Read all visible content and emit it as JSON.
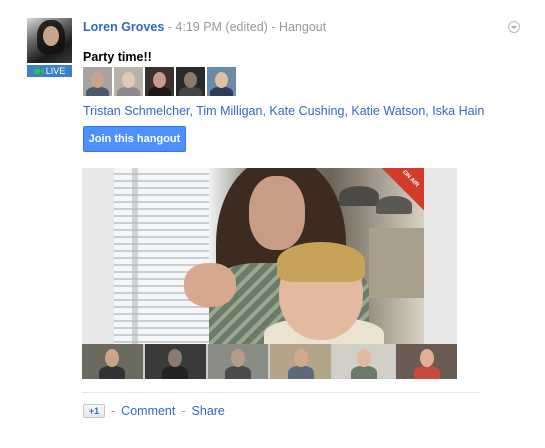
{
  "post": {
    "author": "Loren Groves",
    "timestamp": "4:19 PM (edited)",
    "separator": " - ",
    "type": "Hangout",
    "avatar_badge": "LIVE",
    "text": "Party time!!",
    "participants": "Tristan Schmelcher, Tim Milligan, Kate Cushing, Katie Watson, Iska Hain",
    "join_label": "Join this hangout",
    "on_air_label": "ON AIR",
    "icons": {
      "live": "video-camera-icon",
      "menu": "chevron-down-icon",
      "on_air": "google-plus-icon",
      "plus_one": "plus-one-icon"
    }
  },
  "participant_thumbs": [
    {
      "name": "participant-1",
      "bg": "#a7a3a1",
      "head": "#c8a38b",
      "body": "#4a5a6a"
    },
    {
      "name": "participant-2",
      "bg": "#b9b2a6",
      "head": "#e2c9b6",
      "body": "#8a8a8a"
    },
    {
      "name": "participant-3",
      "bg": "#3a3230",
      "head": "#c79a86",
      "body": "#1e1a18"
    },
    {
      "name": "participant-4",
      "bg": "#2a2a2a",
      "head": "#8a7a6e",
      "body": "#444444"
    },
    {
      "name": "participant-5",
      "bg": "#6a8aa6",
      "head": "#e0c09e",
      "body": "#2e3e5a"
    }
  ],
  "filmstrip": [
    {
      "bg": "#6b6a5e",
      "head": "#c9a38a",
      "body": "#333333"
    },
    {
      "bg": "#3a3a3a",
      "head": "#8a7a70",
      "body": "#222222"
    },
    {
      "bg": "#8a8c86",
      "head": "#b89a86",
      "body": "#4a4a4a"
    },
    {
      "bg": "#b4a48a",
      "head": "#d3a88c",
      "body": "#5a6a7a"
    },
    {
      "bg": "#d2cfc8",
      "head": "#e2b9a0",
      "body": "#6a7c68"
    },
    {
      "bg": "#6a5c52",
      "head": "#e0b097",
      "body": "#c84a3a"
    }
  ],
  "actions": {
    "plus_one_label": "+1",
    "comment_label": "Comment",
    "share_label": "Share",
    "separator": " - "
  },
  "colors": {
    "link": "#3366cc",
    "join_button": "#4d90fe",
    "live_badge": "#3d80c9",
    "on_air": "#d23b2a"
  }
}
